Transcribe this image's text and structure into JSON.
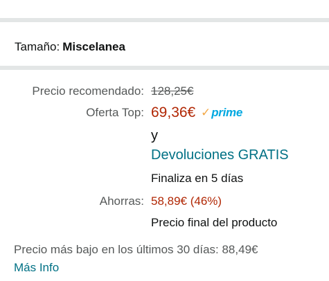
{
  "size": {
    "label": "Tamaño:",
    "value": "Miscelanea"
  },
  "pricing": {
    "list_label": "Precio recomendado:",
    "list_price": "128,25€",
    "deal_label": "Oferta Top:",
    "deal_price": "69,36€",
    "prime_badge": "prime",
    "prime_check": "✓",
    "and_text": "y",
    "returns_link": "Devoluciones GRATIS",
    "ends_text": "Finaliza en 5 días",
    "savings_label": "Ahorras:",
    "savings_value": "58,89€ (46%)",
    "final_price_note": "Precio final del producto"
  },
  "lowest_price": {
    "text": "Precio más bajo en los últimos 30 días: 88,49€",
    "more_info_link": "Más Info"
  },
  "colors": {
    "deal_price": "#b12704",
    "link": "#007185",
    "prime_blue": "#00a8e1",
    "prime_check": "#f3a847",
    "divider": "#e3e6e6"
  }
}
